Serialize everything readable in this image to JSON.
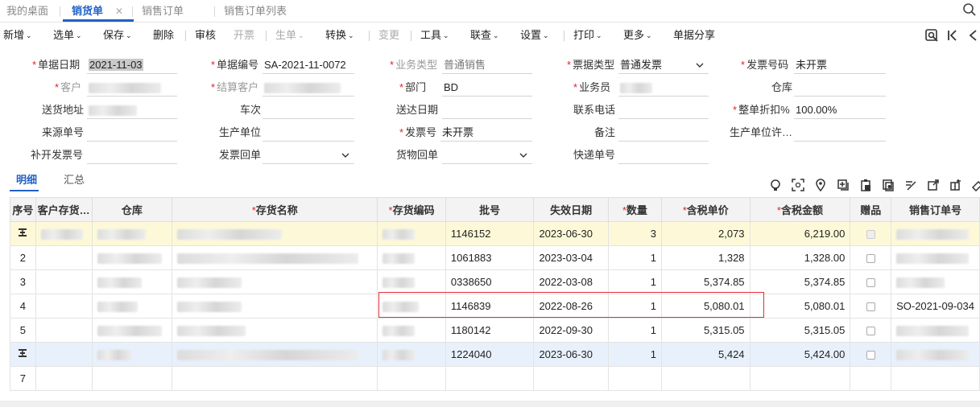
{
  "tabs": [
    {
      "label": "我的桌面"
    },
    {
      "label": "销货单"
    },
    {
      "label": "销售订单"
    },
    {
      "label": "销售订单列表"
    }
  ],
  "tab_close": "✕",
  "toolbar": {
    "items": [
      {
        "label": "新增",
        "caret": "⌄"
      },
      {
        "label": "选单",
        "caret": "⌄"
      },
      {
        "label": "保存",
        "caret": "⌄"
      },
      {
        "label": "删除"
      },
      {
        "label": "审核"
      },
      {
        "label": "开票"
      },
      {
        "label": "生单",
        "caret": "⌄"
      },
      {
        "label": "转换",
        "caret": "⌄"
      },
      {
        "label": "变更"
      },
      {
        "label": "工具",
        "caret": "⌄"
      },
      {
        "label": "联查",
        "caret": "⌄"
      },
      {
        "label": "设置",
        "caret": "⌄"
      },
      {
        "label": "打印",
        "caret": "⌄"
      },
      {
        "label": "更多",
        "caret": "⌄"
      },
      {
        "label": "单据分享"
      }
    ],
    "right_icons": [
      "view-icon",
      "collapse-left-icon",
      "expand-icon"
    ]
  },
  "form": {
    "doc_date": {
      "label": "单据日期",
      "value": "2021-11-03"
    },
    "doc_no": {
      "label": "单据编号",
      "value": "SA-2021-11-0072"
    },
    "biz_type": {
      "label": "业务类型",
      "value": "普通销售"
    },
    "invoice_type": {
      "label": "票据类型",
      "value": "普通发票"
    },
    "invoice_code": {
      "label": "发票号码",
      "value": "未开票"
    },
    "customer": {
      "label": "客户",
      "value": ""
    },
    "settle_customer": {
      "label": "结算客户",
      "value": ""
    },
    "department": {
      "label": "部门",
      "value": "BD"
    },
    "salesperson": {
      "label": "业务员",
      "value": ""
    },
    "warehouse": {
      "label": "仓库",
      "value": ""
    },
    "ship_address": {
      "label": "送货地址",
      "value": ""
    },
    "trip": {
      "label": "车次",
      "value": ""
    },
    "delivery_date": {
      "label": "送达日期",
      "value": ""
    },
    "contact_phone": {
      "label": "联系电话",
      "value": ""
    },
    "discount": {
      "label": "整单折扣%",
      "value": "100.00%"
    },
    "source_no": {
      "label": "来源单号",
      "value": ""
    },
    "production_unit": {
      "label": "生产单位",
      "value": ""
    },
    "invoice_no": {
      "label": "发票号",
      "value": "未开票"
    },
    "remark": {
      "label": "备注",
      "value": ""
    },
    "production_license": {
      "label": "生产单位许…",
      "value": ""
    },
    "reissue_invoice": {
      "label": "补开发票号",
      "value": ""
    },
    "invoice_receipt": {
      "label": "发票回单",
      "value": ""
    },
    "goods_receipt": {
      "label": "货物回单",
      "value": ""
    },
    "express_no": {
      "label": "快递单号",
      "value": ""
    }
  },
  "subtabs": [
    {
      "label": "明细"
    },
    {
      "label": "汇总"
    }
  ],
  "grid_icons": [
    "bulb-icon",
    "scan-icon",
    "location-icon",
    "add-row-icon",
    "paste-icon",
    "copy-icon",
    "edit-icon",
    "export-icon",
    "split-icon",
    "eraser-icon"
  ],
  "grid": {
    "columns": [
      {
        "label": "序号",
        "required": false
      },
      {
        "label": "客户存货…",
        "required": false
      },
      {
        "label": "仓库",
        "required": false
      },
      {
        "label": "存货名称",
        "required": true
      },
      {
        "label": "存货编码",
        "required": true
      },
      {
        "label": "批号",
        "required": false
      },
      {
        "label": "失效日期",
        "required": false
      },
      {
        "label": "数量",
        "required": true
      },
      {
        "label": "含税单价",
        "required": true
      },
      {
        "label": "含税金额",
        "required": true
      },
      {
        "label": "赠品",
        "required": false
      },
      {
        "label": "销售订单号",
        "required": false
      }
    ],
    "rows": [
      {
        "seq": "",
        "batch": "1146152",
        "expiry": "2023-06-30",
        "qty": "3",
        "price": "2,073",
        "amount": "6,219.00",
        "order_no": ""
      },
      {
        "seq": "2",
        "batch": "1061883",
        "expiry": "2023-03-04",
        "qty": "1",
        "price": "1,328",
        "amount": "1,328.00",
        "order_no": ""
      },
      {
        "seq": "3",
        "batch": "0338650",
        "expiry": "2022-03-08",
        "qty": "1",
        "price": "5,374.85",
        "amount": "5,374.85",
        "order_no": ""
      },
      {
        "seq": "4",
        "batch": "1146839",
        "expiry": "2022-08-26",
        "qty": "1",
        "price": "5,080.01",
        "amount": "5,080.01",
        "order_no": "SO-2021-09-034"
      },
      {
        "seq": "5",
        "batch": "1180142",
        "expiry": "2022-09-30",
        "qty": "1",
        "price": "5,315.05",
        "amount": "5,315.05",
        "order_no": ""
      },
      {
        "seq": "",
        "batch": "1224040",
        "expiry": "2023-06-30",
        "qty": "1",
        "price": "5,424",
        "amount": "5,424.00",
        "order_no": ""
      },
      {
        "seq": "7",
        "batch": "",
        "expiry": "",
        "qty": "",
        "price": "",
        "amount": "",
        "order_no": ""
      }
    ]
  },
  "colors": {
    "accent": "#1f62c7",
    "required": "#e0202a",
    "highlight_row": "#fdf9d8",
    "selected_row": "#e8f1fb",
    "error_box": "#e0303a"
  }
}
